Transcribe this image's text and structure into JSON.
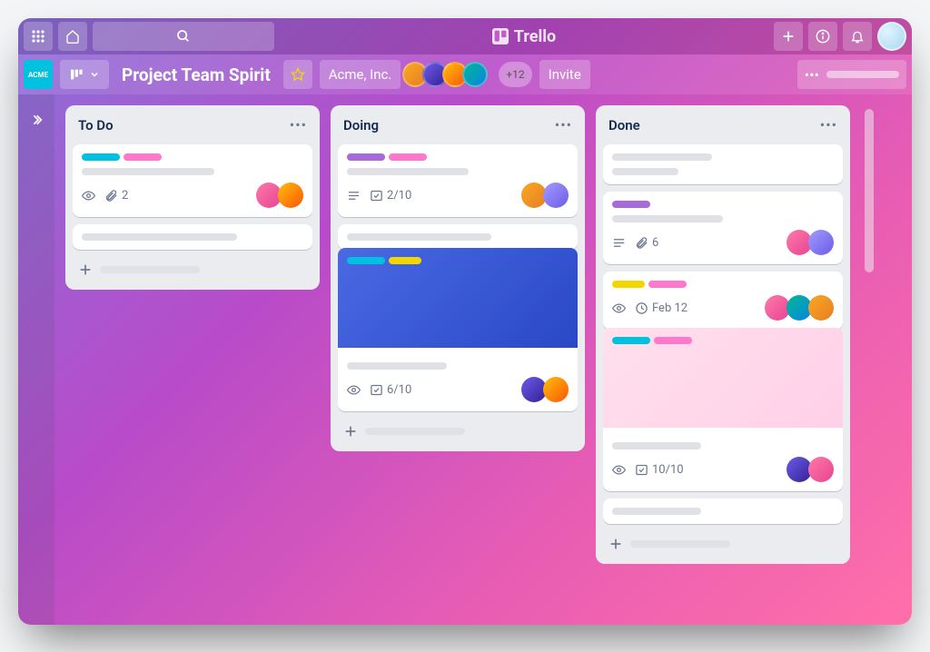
{
  "app": {
    "name": "Trello"
  },
  "topbar": {
    "logo_label": "ACME"
  },
  "board": {
    "title": "Project Team Spirit",
    "workspace": "Acme, Inc.",
    "more_members": "+12",
    "invite_label": "Invite"
  },
  "lists": [
    {
      "title": "To Do"
    },
    {
      "title": "Doing"
    },
    {
      "title": "Done"
    }
  ],
  "cards": {
    "todo_1": {
      "attachment_count": "2"
    },
    "doing_1": {
      "checklist": "2/10"
    },
    "doing_2": {
      "checklist": "6/10"
    },
    "done_2": {
      "attachment_count": "6"
    },
    "done_3": {
      "due_date": "Feb 12"
    },
    "done_4": {
      "checklist": "10/10"
    }
  }
}
